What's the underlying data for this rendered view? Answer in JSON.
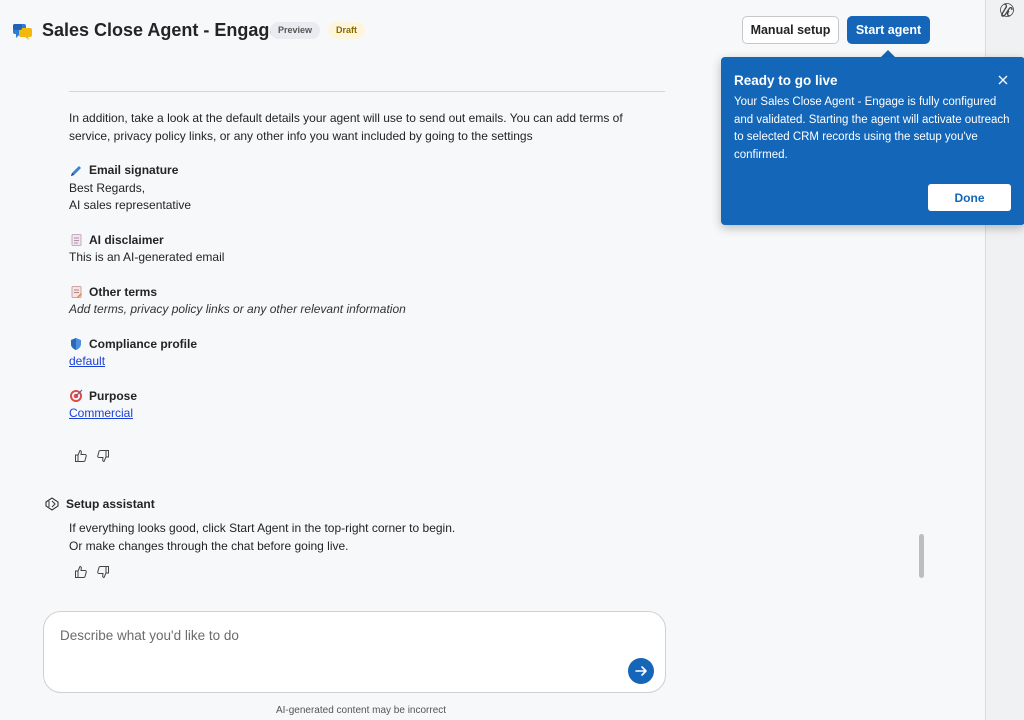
{
  "header": {
    "title": "Sales Close Agent - Engage",
    "badge_preview": "Preview",
    "badge_draft": "Draft",
    "manual_setup_label": "Manual setup",
    "start_agent_label": "Start agent"
  },
  "colors": {
    "accent": "#1565b8",
    "link": "#1a3fd6"
  },
  "content": {
    "intro": "In addition, take a look at the default details your agent will use to send out emails. You can add terms of service, privacy policy links, or any other info you want included by going to the settings",
    "sections": [
      {
        "icon": "pen-icon",
        "title": "Email signature",
        "lines": [
          "Best Regards,",
          "AI sales representative"
        ]
      },
      {
        "icon": "document-icon",
        "title": "AI disclaimer",
        "lines": [
          "This is an AI-generated email"
        ]
      },
      {
        "icon": "notepad-icon",
        "title": "Other terms",
        "lines": [
          "Add terms, privacy policy links or any other relevant information"
        ]
      },
      {
        "icon": "shield-icon",
        "title": "Compliance profile",
        "link": "default"
      },
      {
        "icon": "target-icon",
        "title": "Purpose",
        "link": "Commercial"
      }
    ]
  },
  "assistant": {
    "name": "Setup assistant",
    "line1": "If everything looks good, click Start Agent in the top-right corner to begin.",
    "line2": "Or make changes through the chat before going live."
  },
  "composer": {
    "placeholder": "Describe what you'd like to do"
  },
  "footer": {
    "disclaimer": "AI-generated content may be incorrect"
  },
  "popover": {
    "title": "Ready to go live",
    "body": "Your Sales Close Agent - Engage is fully configured and validated. Starting the agent will activate outreach to selected CRM records using the setup you've confirmed.",
    "done_label": "Done"
  }
}
